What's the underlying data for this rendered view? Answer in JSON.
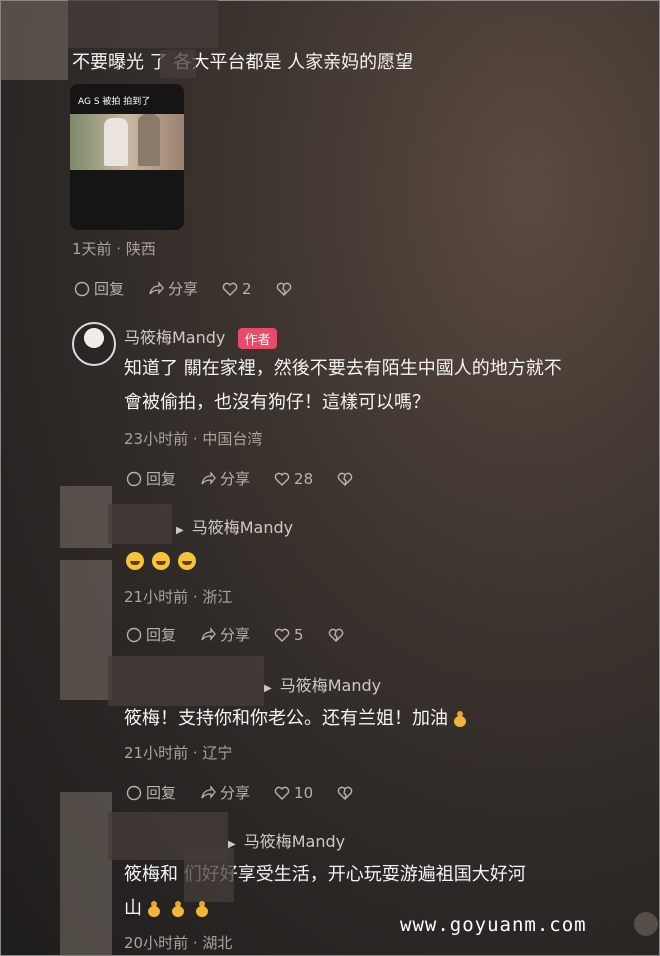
{
  "comments": [
    {
      "text": "不要曝光 了 各大平台都是 人家亲妈的愿望",
      "meta": "1天前 · 陕西",
      "reply_label": "回复",
      "share_label": "分享",
      "likes": "2"
    }
  ],
  "author_reply": {
    "name": "马筱梅Mandy",
    "tag": "作者",
    "line1": "知道了 關在家裡，然後不要去有陌生中國人的地方就不",
    "line2": "會被偷拍，也沒有狗仔！這樣可以嗎？",
    "meta": "23小时前 · 中国台湾",
    "reply_label": "回复",
    "share_label": "分享",
    "likes": "28"
  },
  "replies": [
    {
      "to": "马筱梅Mandy",
      "meta": "21小时前 · 浙江",
      "reply_label": "回复",
      "share_label": "分享",
      "likes": "5"
    },
    {
      "to": "马筱梅Mandy",
      "text": "筱梅！支持你和你老公。还有兰姐！加油",
      "meta": "21小时前 · 辽宁",
      "reply_label": "回复",
      "share_label": "分享",
      "likes": "10"
    },
    {
      "to": "马筱梅Mandy",
      "line1": "筱梅和 们好好享受生活，开心玩耍游遍祖国大好河",
      "line2": "山",
      "meta": "20小时前 · 湖北"
    }
  ],
  "thumbnail": {
    "caption": "AG S 被拍 拍到了"
  },
  "watermark": "www.goyuanm.com"
}
